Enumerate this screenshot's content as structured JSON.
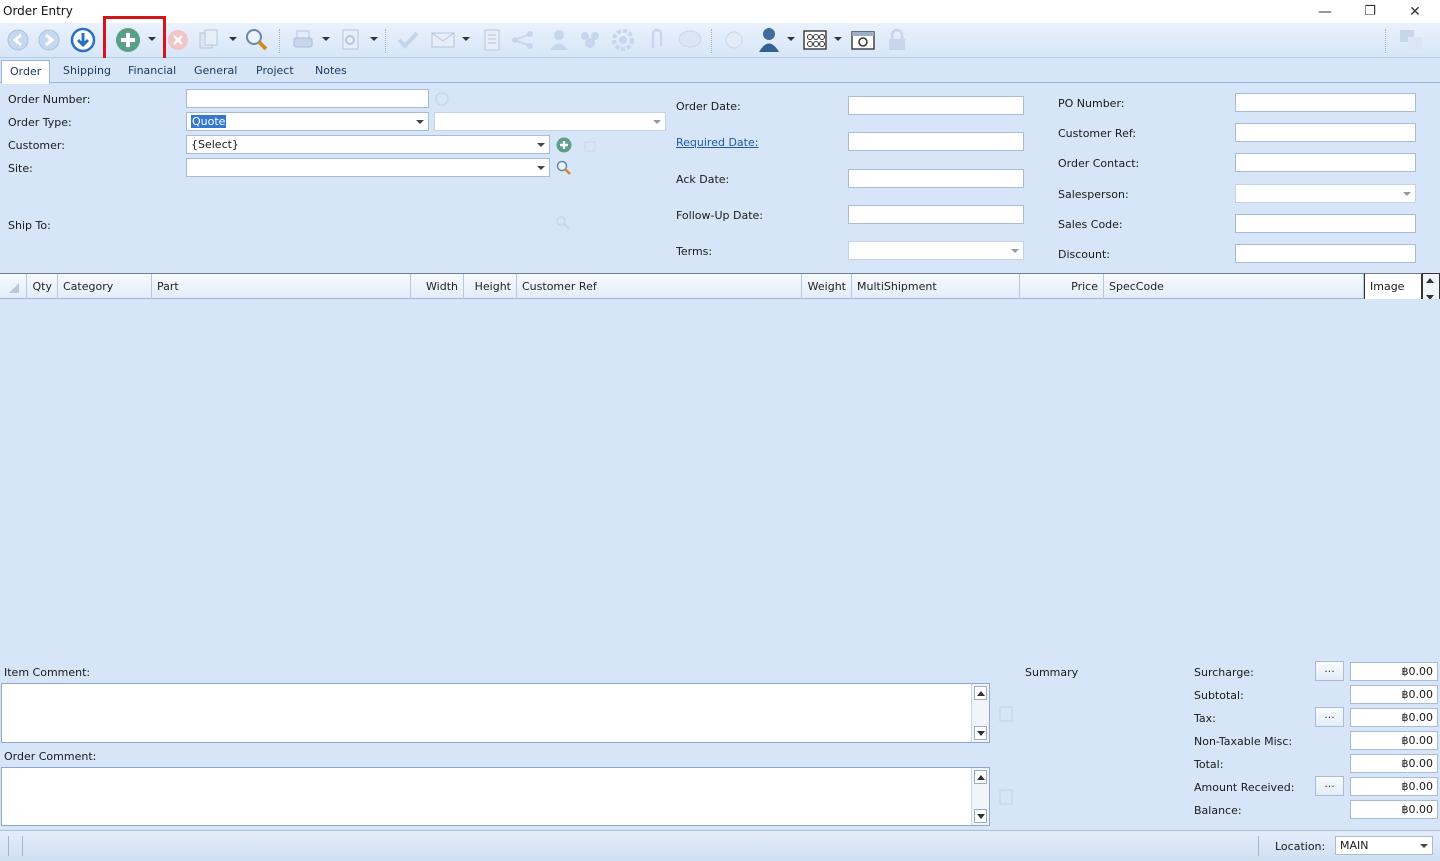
{
  "window": {
    "title": "Order Entry",
    "minimize": "—",
    "restore": "❐",
    "close": "✕"
  },
  "toolbar": {
    "icons": [
      "back-icon",
      "forward-icon",
      "download-icon",
      "add-icon",
      "delete-icon",
      "copy-icon",
      "search-icon",
      "print-icon",
      "preview-icon",
      "approve-icon",
      "email-icon",
      "report-icon",
      "workflow-icon",
      "user-icon",
      "group-icon",
      "settings-icon",
      "attach-icon",
      "comment-icon",
      "help-icon",
      "person-icon",
      "options-icon",
      "screen-icon",
      "lock-icon",
      "language-icon"
    ]
  },
  "tabs": [
    "Order",
    "Shipping",
    "Financial",
    "General",
    "Project",
    "Notes"
  ],
  "form": {
    "order_number_label": "Order Number:",
    "order_number_value": "",
    "order_type_label": "Order Type:",
    "order_type_value": "Quote",
    "order_subtype_value": "",
    "customer_label": "Customer:",
    "customer_value": "{Select}",
    "site_label": "Site:",
    "site_value": "",
    "ship_to_label": "Ship To:",
    "order_date_label": "Order Date:",
    "required_date_label": "Required Date:",
    "ack_date_label": "Ack Date:",
    "followup_date_label": "Follow-Up Date:",
    "terms_label": "Terms:",
    "po_number_label": "PO Number:",
    "customer_ref_label": "Customer Ref:",
    "order_contact_label": "Order Contact:",
    "salesperson_label": "Salesperson:",
    "sales_code_label": "Sales Code:",
    "discount_label": "Discount:"
  },
  "grid": {
    "columns": [
      "Qty",
      "Category",
      "Part",
      "Width",
      "Height",
      "Customer Ref",
      "Weight",
      "MultiShipment",
      "Price",
      "SpecCode",
      "Image"
    ]
  },
  "comments": {
    "item_label": "Item Comment:",
    "order_label": "Order Comment:"
  },
  "summary": {
    "title": "Summary",
    "ellipsis": "...",
    "surcharge_label": "Surcharge:",
    "surcharge": "฿0.00",
    "subtotal_label": "Subtotal:",
    "subtotal": "฿0.00",
    "tax_label": "Tax:",
    "tax": "฿0.00",
    "nontax_label": "Non-Taxable Misc:",
    "nontax": "฿0.00",
    "total_label": "Total:",
    "total": "฿0.00",
    "received_label": "Amount Received:",
    "received": "฿0.00",
    "balance_label": "Balance:",
    "balance": "฿0.00"
  },
  "status": {
    "location_label": "Location:",
    "location_value": "MAIN"
  },
  "colors": {
    "accent": "#3578d1",
    "highlight": "#d4151b",
    "link": "#1e5aa8",
    "background": "#d6e5f8"
  }
}
